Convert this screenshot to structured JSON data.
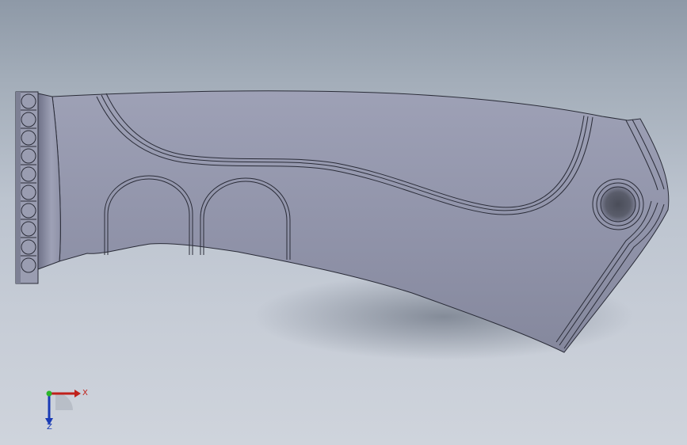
{
  "viewport": {
    "background_top": "#8e99a7",
    "background_bottom": "#cfd4dc",
    "model_color": "#9396ac"
  },
  "triad": {
    "x_label": "X",
    "z_label": "Z",
    "x_color": "#c0201a",
    "y_color": "#2bb52b",
    "z_color": "#1a3bb5"
  }
}
